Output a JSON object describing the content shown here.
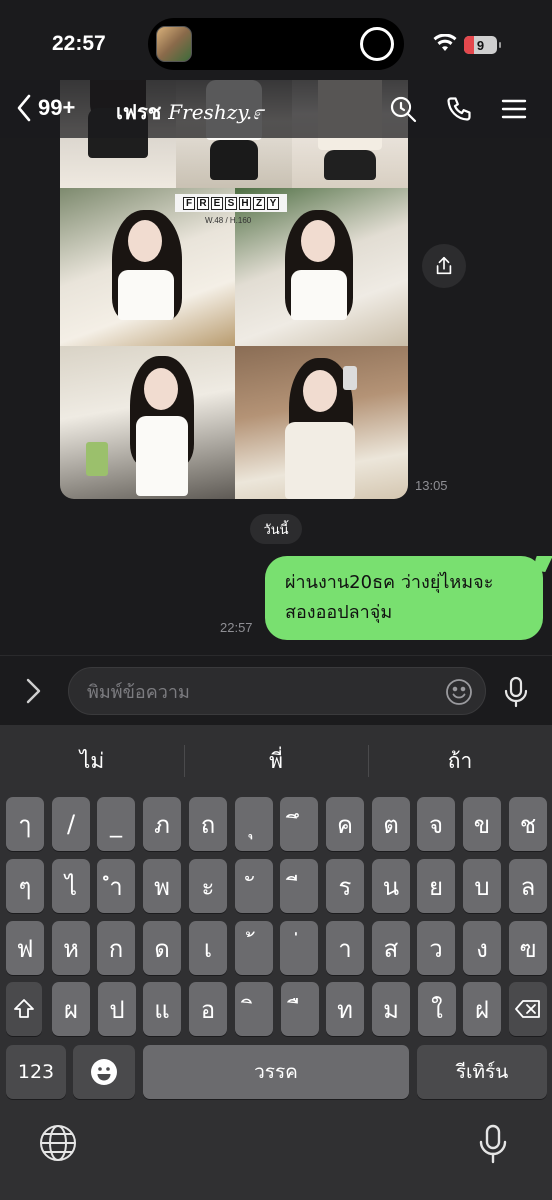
{
  "status_bar": {
    "time": "22:57",
    "battery": "9"
  },
  "header": {
    "back_count": "99+",
    "chat_name_thai": "เฟรช ",
    "chat_name_latin": "Freshzy.೯"
  },
  "messages": [
    {
      "type": "image",
      "time": "13:05",
      "brand_text": "FRESHZY",
      "brand_sub": "W.48 / H.160"
    },
    {
      "type": "date",
      "label": "วันนี้"
    },
    {
      "type": "text",
      "line1": "ผ่านงาน20ธค ว่างยุ่ไหมจะ",
      "line2": "สองออปลาจุ่ม",
      "time": "22:57"
    }
  ],
  "input": {
    "placeholder": "พิมพ์ข้อความ",
    "value": ""
  },
  "keyboard": {
    "suggestions": [
      "ไม่",
      "พี่",
      "ถ้า"
    ],
    "row1": [
      "ๅ",
      "/",
      "_",
      "ภ",
      "ถ",
      "ุ",
      "ึ",
      "ค",
      "ต",
      "จ",
      "ข",
      "ช"
    ],
    "row2": [
      "ๆ",
      "ไ",
      "ำ",
      "พ",
      "ะ",
      "ั",
      "ี",
      "ร",
      "น",
      "ย",
      "บ",
      "ล"
    ],
    "row3": [
      "ฟ",
      "ห",
      "ก",
      "ด",
      "เ",
      "้",
      "่",
      "า",
      "ส",
      "ว",
      "ง",
      "ฃ"
    ],
    "row4": [
      "ผ",
      "ป",
      "แ",
      "อ",
      "ิ",
      "ื",
      "ท",
      "ม",
      "ใ",
      "ฝ"
    ],
    "numbers_label": "123",
    "space_label": "วรรค",
    "return_label": "รีเทิร์น"
  },
  "colors": {
    "bubble": "#79e070",
    "background": "#1b1b1d",
    "key": "#6b6b6e",
    "key_dark": "#4a4a4c"
  }
}
